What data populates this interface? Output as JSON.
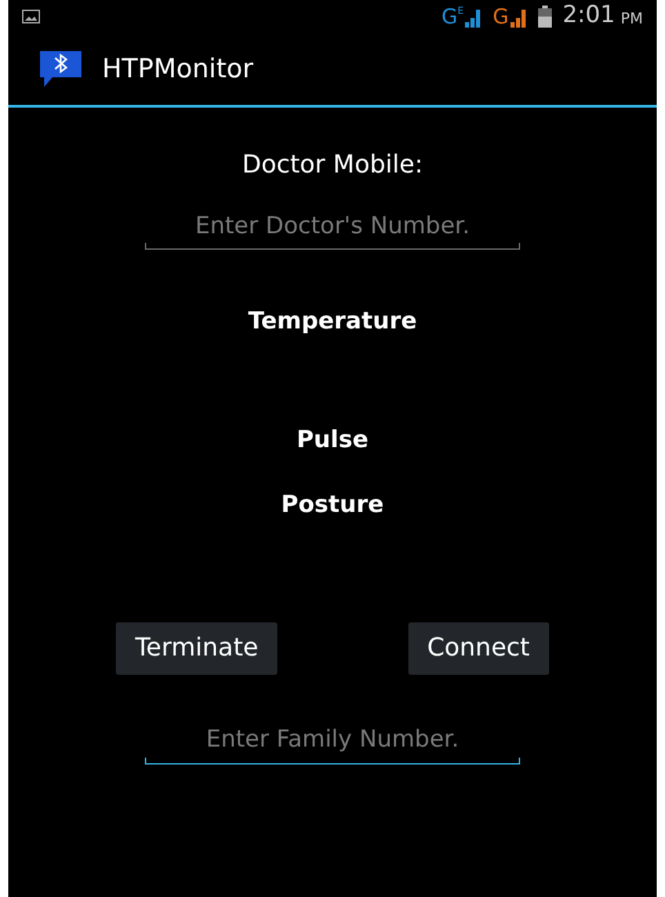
{
  "status_bar": {
    "networks": [
      {
        "letter": "G",
        "sub": "E",
        "color": "#1f8fd6"
      },
      {
        "letter": "G",
        "color": "#e0701a"
      }
    ],
    "time": "2:01",
    "meridiem": "PM"
  },
  "app_bar": {
    "title": "HTPMonitor"
  },
  "doctor_label": "Doctor Mobile:",
  "doctor_field": {
    "placeholder": "Enter Doctor's Number.",
    "focused": false
  },
  "readings": [
    {
      "label": "Temperature"
    },
    {
      "label": "Pulse"
    },
    {
      "label": "Posture"
    }
  ],
  "buttons": [
    {
      "label": "Terminate"
    },
    {
      "label": "Connect"
    }
  ],
  "family_field": {
    "placeholder": "Enter Family Number.",
    "focused": true
  }
}
